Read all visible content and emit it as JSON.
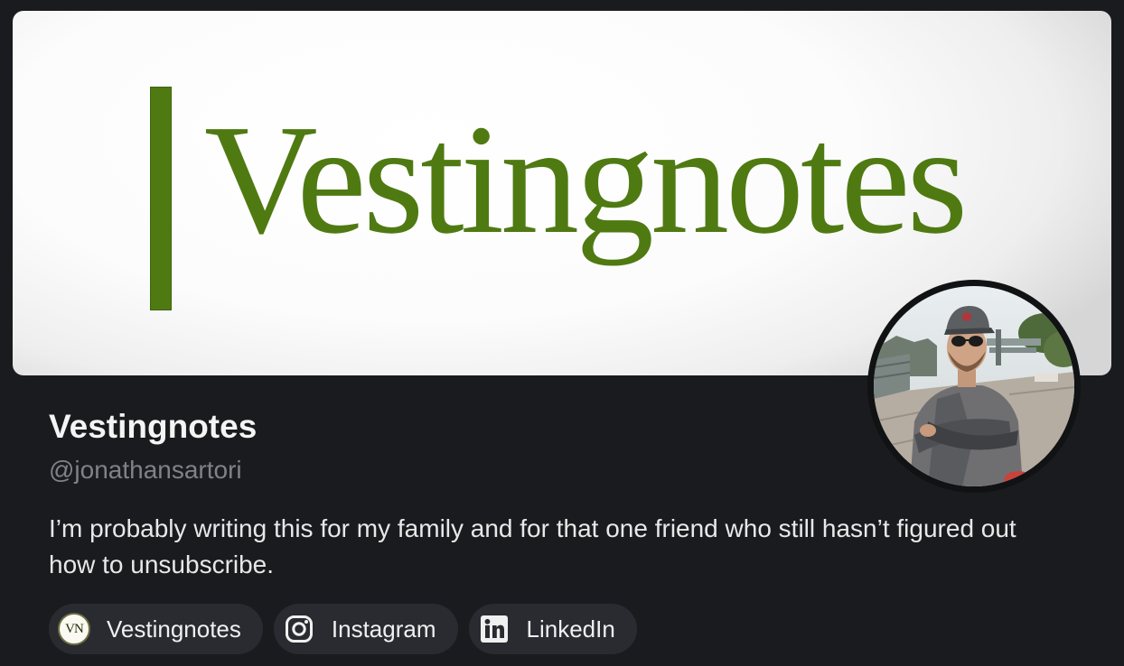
{
  "banner": {
    "wordmark": "Vestingnotes",
    "brand_color": "#4f7a12"
  },
  "profile": {
    "name": "Vestingnotes",
    "handle": "@jonathansartori",
    "bio": "I’m probably writing this for my family and for that one friend who still hasn’t figured out how to unsubscribe.",
    "avatar_icon": "profile-photo-man-in-cap"
  },
  "links": [
    {
      "label": "Vestingnotes",
      "icon": "vn-logo-icon",
      "badge_text": "VN"
    },
    {
      "label": "Instagram",
      "icon": "instagram-icon"
    },
    {
      "label": "LinkedIn",
      "icon": "linkedin-icon"
    }
  ],
  "colors": {
    "background": "#1a1b1f",
    "pill": "#2a2b31",
    "handle": "#808189"
  }
}
